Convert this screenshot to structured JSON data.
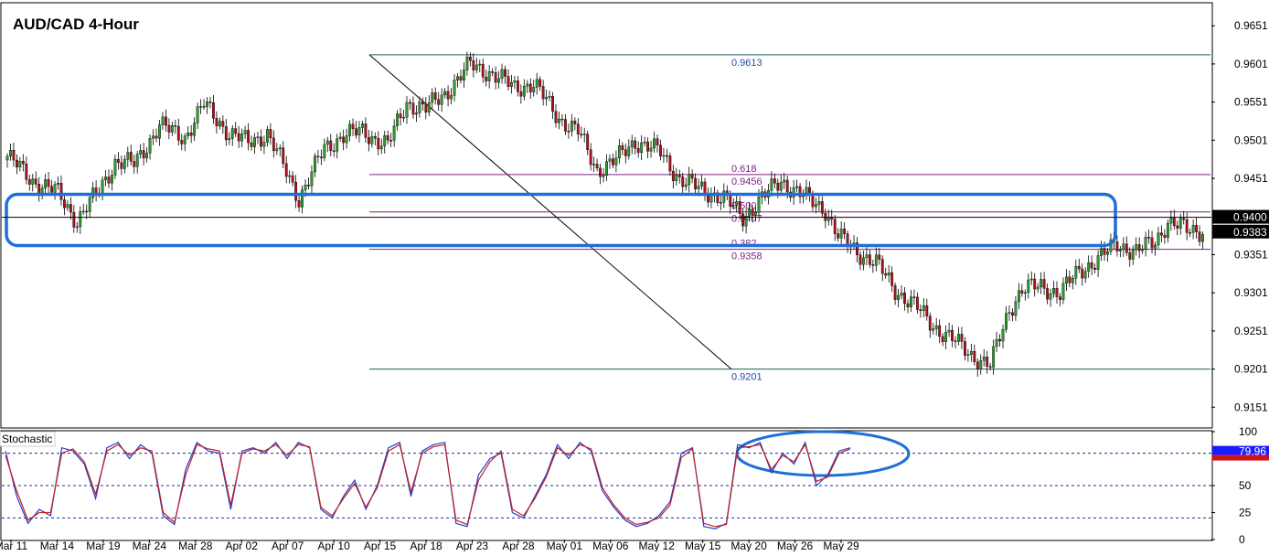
{
  "chart_data": [
    {
      "type": "candlestick",
      "title": "AUD/CAD 4-Hour",
      "x_tick_labels": [
        "Mar 11",
        "Mar 14",
        "Mar 19",
        "Mar 24",
        "Mar 28",
        "Apr 02",
        "Apr 07",
        "Apr 10",
        "Apr 15",
        "Apr 18",
        "Apr 23",
        "Apr 28",
        "May 01",
        "May 06",
        "May 12",
        "May 15",
        "May 20",
        "May 26",
        "May 29"
      ],
      "y_tick_labels": [
        "0.9651",
        "0.9601",
        "0.9551",
        "0.9501",
        "0.9451",
        "0.9351",
        "0.9301",
        "0.9251",
        "0.9201",
        "0.9151"
      ],
      "ylim": [
        0.9125,
        0.968
      ],
      "grid": false,
      "price_path": {
        "index": [
          0,
          8,
          16,
          22,
          28,
          34,
          40,
          48,
          56,
          62,
          70,
          76,
          82,
          92,
          100,
          106,
          112,
          120,
          126,
          132,
          138,
          146,
          152,
          160,
          166,
          174,
          180,
          186,
          192,
          198,
          206,
          212,
          218,
          226,
          232,
          238,
          244,
          252,
          258,
          262,
          268,
          274,
          280,
          286,
          292,
          298,
          304,
          310,
          316,
          320,
          326,
          332,
          338,
          344,
          350,
          356,
          362,
          366,
          372,
          376
        ],
        "close": [
          0.948,
          0.9448,
          0.9432,
          0.9395,
          0.943,
          0.9472,
          0.947,
          0.952,
          0.9505,
          0.9548,
          0.951,
          0.9498,
          0.951,
          0.9425,
          0.949,
          0.9508,
          0.9512,
          0.9495,
          0.955,
          0.9542,
          0.9562,
          0.96,
          0.959,
          0.957,
          0.9575,
          0.953,
          0.9512,
          0.9462,
          0.9475,
          0.95,
          0.9485,
          0.945,
          0.9438,
          0.9425,
          0.94,
          0.9425,
          0.9448,
          0.9425,
          0.941,
          0.9375,
          0.9355,
          0.934,
          0.9305,
          0.9285,
          0.9258,
          0.924,
          0.922,
          0.9205,
          0.928,
          0.9305,
          0.931,
          0.93,
          0.933,
          0.9345,
          0.9365,
          0.9355,
          0.9368,
          0.9395,
          0.9383,
          0.9383
        ]
      },
      "price_labels": [
        "0.9613",
        "0.9201",
        "0.9407",
        "0.9358",
        "0.9456"
      ],
      "fibonacci": {
        "high": 0.9613,
        "low": 0.9201,
        "levels": [
          {
            "ratio": "0.618",
            "price": 0.9456,
            "label": "0.9456"
          },
          {
            "ratio": "0.500",
            "price": 0.9407,
            "label": "0.9407"
          },
          {
            "ratio": "0.382",
            "price": 0.9358,
            "label": "0.9358"
          }
        ]
      },
      "current_price": {
        "bid": "0.9400",
        "value": "0.9383"
      },
      "annotation_zone": {
        "shape": "rounded-rectangle",
        "color": "#1e6fd9",
        "from": 0.9363,
        "to": 0.943
      },
      "colors": {
        "up": "#2e9e2e",
        "down": "#b0121b",
        "fib_main": "#1f5f5f",
        "fib_retrace": "#7f1f7f",
        "fib_text_main": "#1f4ea0",
        "annotation": "#1e6fd9"
      }
    },
    {
      "type": "line",
      "title": "Stochastic",
      "y_tick_labels": [
        "100",
        "50",
        "25",
        "0"
      ],
      "ylim": [
        0,
        100
      ],
      "levels": [
        80,
        50,
        20
      ],
      "current_value": "79.96",
      "annotation": {
        "shape": "ellipse",
        "color": "#1e6fd9",
        "zone": "overbought, May 20 to May 29"
      },
      "series": [
        {
          "color": "#1e3fd0",
          "values": [
            82,
            40,
            15,
            28,
            22,
            85,
            82,
            70,
            38,
            85,
            90,
            75,
            88,
            80,
            22,
            14,
            65,
            90,
            82,
            80,
            28,
            82,
            85,
            80,
            90,
            75,
            90,
            85,
            28,
            20,
            40,
            55,
            28,
            50,
            85,
            90,
            40,
            82,
            88,
            90,
            15,
            12,
            60,
            75,
            80,
            25,
            20,
            40,
            60,
            88,
            75,
            90,
            82,
            45,
            30,
            18,
            12,
            15,
            22,
            35,
            80,
            85,
            12,
            10,
            15,
            88,
            85,
            90,
            62,
            80,
            70,
            90,
            50,
            60,
            82,
            85
          ]
        },
        {
          "color": "#c42020",
          "values": [
            78,
            45,
            18,
            25,
            25,
            80,
            84,
            72,
            42,
            82,
            88,
            78,
            85,
            82,
            25,
            16,
            60,
            88,
            84,
            82,
            32,
            80,
            84,
            82,
            88,
            78,
            88,
            86,
            30,
            22,
            38,
            52,
            30,
            48,
            82,
            88,
            44,
            80,
            86,
            88,
            18,
            14,
            55,
            72,
            82,
            28,
            22,
            38,
            58,
            85,
            78,
            88,
            84,
            48,
            32,
            20,
            14,
            16,
            20,
            32,
            76,
            84,
            15,
            12,
            14,
            85,
            86,
            88,
            65,
            78,
            72,
            88,
            54,
            58,
            80,
            84
          ]
        }
      ]
    }
  ]
}
